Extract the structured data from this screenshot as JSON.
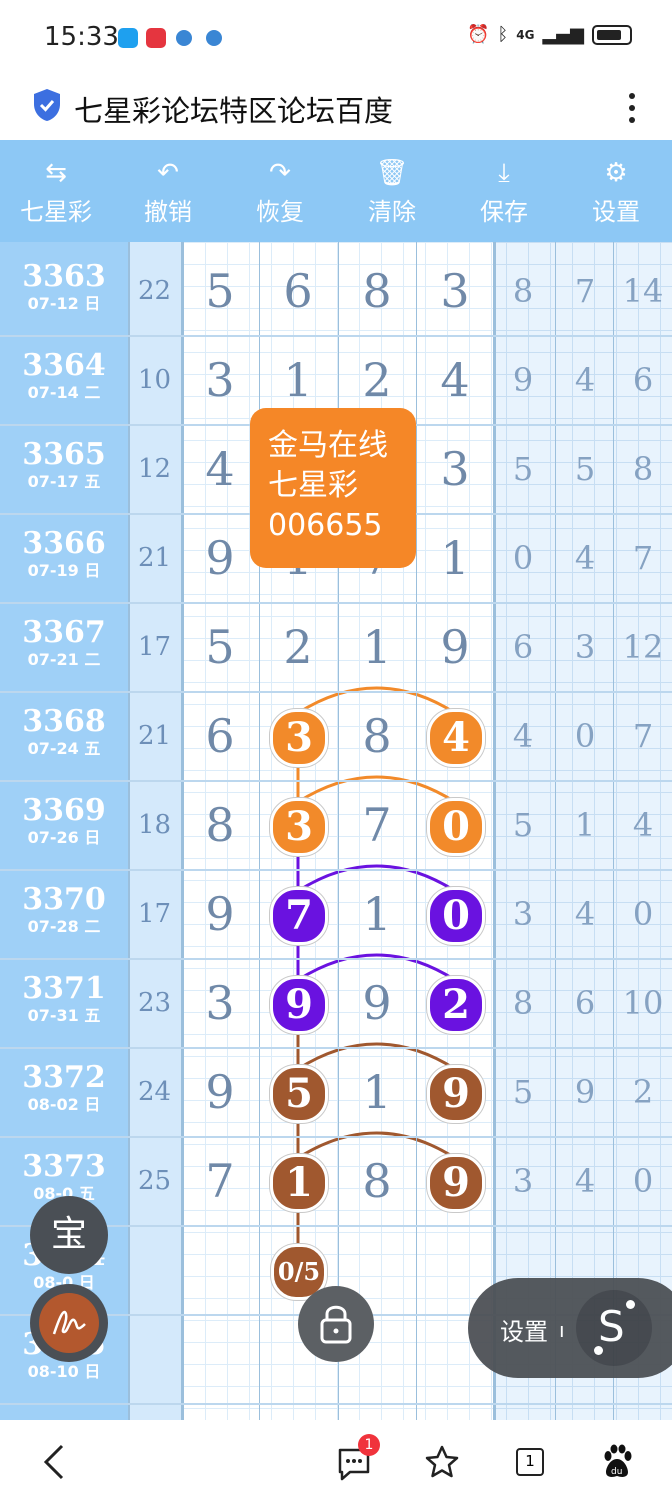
{
  "status_bar": {
    "time": "15:33",
    "network": "4G"
  },
  "title_bar": {
    "title": "七星彩论坛特区论坛百度"
  },
  "toolbar": {
    "items": [
      {
        "icon": "swap-icon",
        "glyph": "⇆",
        "label": "七星彩"
      },
      {
        "icon": "undo-icon",
        "glyph": "↶",
        "label": "撤销"
      },
      {
        "icon": "redo-icon",
        "glyph": "↷",
        "label": "恢复"
      },
      {
        "icon": "trash-icon",
        "glyph": "🗑",
        "label": "清除"
      },
      {
        "icon": "download-icon",
        "glyph": "⤓",
        "label": "保存"
      },
      {
        "icon": "gear-icon",
        "glyph": "⚙",
        "label": "设置"
      }
    ]
  },
  "rows": [
    {
      "issue": "3363",
      "date": "07-12 日",
      "sum": "22",
      "digits": [
        "5",
        "6",
        "8",
        "3"
      ],
      "tail": [
        "8",
        "7",
        "14"
      ]
    },
    {
      "issue": "3364",
      "date": "07-14 二",
      "sum": "10",
      "digits": [
        "3",
        "1",
        "2",
        "4"
      ],
      "tail": [
        "9",
        "4",
        "6"
      ]
    },
    {
      "issue": "3365",
      "date": "07-17 五",
      "sum": "12",
      "digits": [
        "4",
        "",
        "",
        "3"
      ],
      "tail": [
        "5",
        "5",
        "8"
      ]
    },
    {
      "issue": "3366",
      "date": "07-19 日",
      "sum": "21",
      "digits": [
        "9",
        "1",
        "7",
        "1"
      ],
      "tail": [
        "0",
        "4",
        "7"
      ]
    },
    {
      "issue": "3367",
      "date": "07-21 二",
      "sum": "17",
      "digits": [
        "5",
        "2",
        "1",
        "9"
      ],
      "tail": [
        "6",
        "3",
        "12"
      ]
    },
    {
      "issue": "3368",
      "date": "07-24 五",
      "sum": "21",
      "digits": [
        "6",
        "3",
        "8",
        "4"
      ],
      "tail": [
        "4",
        "0",
        "7"
      ]
    },
    {
      "issue": "3369",
      "date": "07-26 日",
      "sum": "18",
      "digits": [
        "8",
        "3",
        "7",
        "0"
      ],
      "tail": [
        "5",
        "1",
        "4"
      ]
    },
    {
      "issue": "3370",
      "date": "07-28 二",
      "sum": "17",
      "digits": [
        "9",
        "7",
        "1",
        "0"
      ],
      "tail": [
        "3",
        "4",
        "0"
      ]
    },
    {
      "issue": "3371",
      "date": "07-31 五",
      "sum": "23",
      "digits": [
        "3",
        "9",
        "9",
        "2"
      ],
      "tail": [
        "8",
        "6",
        "10"
      ]
    },
    {
      "issue": "3372",
      "date": "08-02 日",
      "sum": "24",
      "digits": [
        "9",
        "5",
        "1",
        "9"
      ],
      "tail": [
        "5",
        "9",
        "2"
      ]
    },
    {
      "issue": "3373",
      "date": "08-0 五",
      "sum": "25",
      "digits": [
        "7",
        "1",
        "8",
        "9"
      ],
      "tail": [
        "3",
        "4",
        "0"
      ]
    },
    {
      "issue": "3374",
      "date": "08-0 日",
      "sum": "",
      "digits": [
        "",
        "",
        "",
        ""
      ],
      "tail": [
        "",
        "",
        ""
      ]
    },
    {
      "issue": "3375",
      "date": "08-10 日",
      "sum": "",
      "digits": [
        "",
        "",
        "",
        ""
      ],
      "tail": [
        "",
        "",
        ""
      ]
    }
  ],
  "highlights": [
    {
      "row": 5,
      "color": "orange",
      "cols": [
        1,
        3
      ]
    },
    {
      "row": 6,
      "color": "orange",
      "cols": [
        1,
        3
      ]
    },
    {
      "row": 7,
      "color": "purple",
      "cols": [
        1,
        3
      ]
    },
    {
      "row": 8,
      "color": "purple",
      "cols": [
        1,
        3
      ]
    },
    {
      "row": 9,
      "color": "brown",
      "cols": [
        1,
        3
      ]
    },
    {
      "row": 10,
      "color": "brown",
      "cols": [
        1,
        3
      ]
    }
  ],
  "colors": {
    "orange": "#f28a2a",
    "purple": "#6a12e0",
    "brown": "#a0582f"
  },
  "counter_ball": "0/5",
  "popup": {
    "line1": "金马在线",
    "line2": "七星彩",
    "line3": "006655"
  },
  "fabs": {
    "treasure_label": "宝",
    "settings_label": "设置",
    "s_label": "S"
  },
  "nav": {
    "badge_count": "1",
    "tab_count": "1"
  }
}
